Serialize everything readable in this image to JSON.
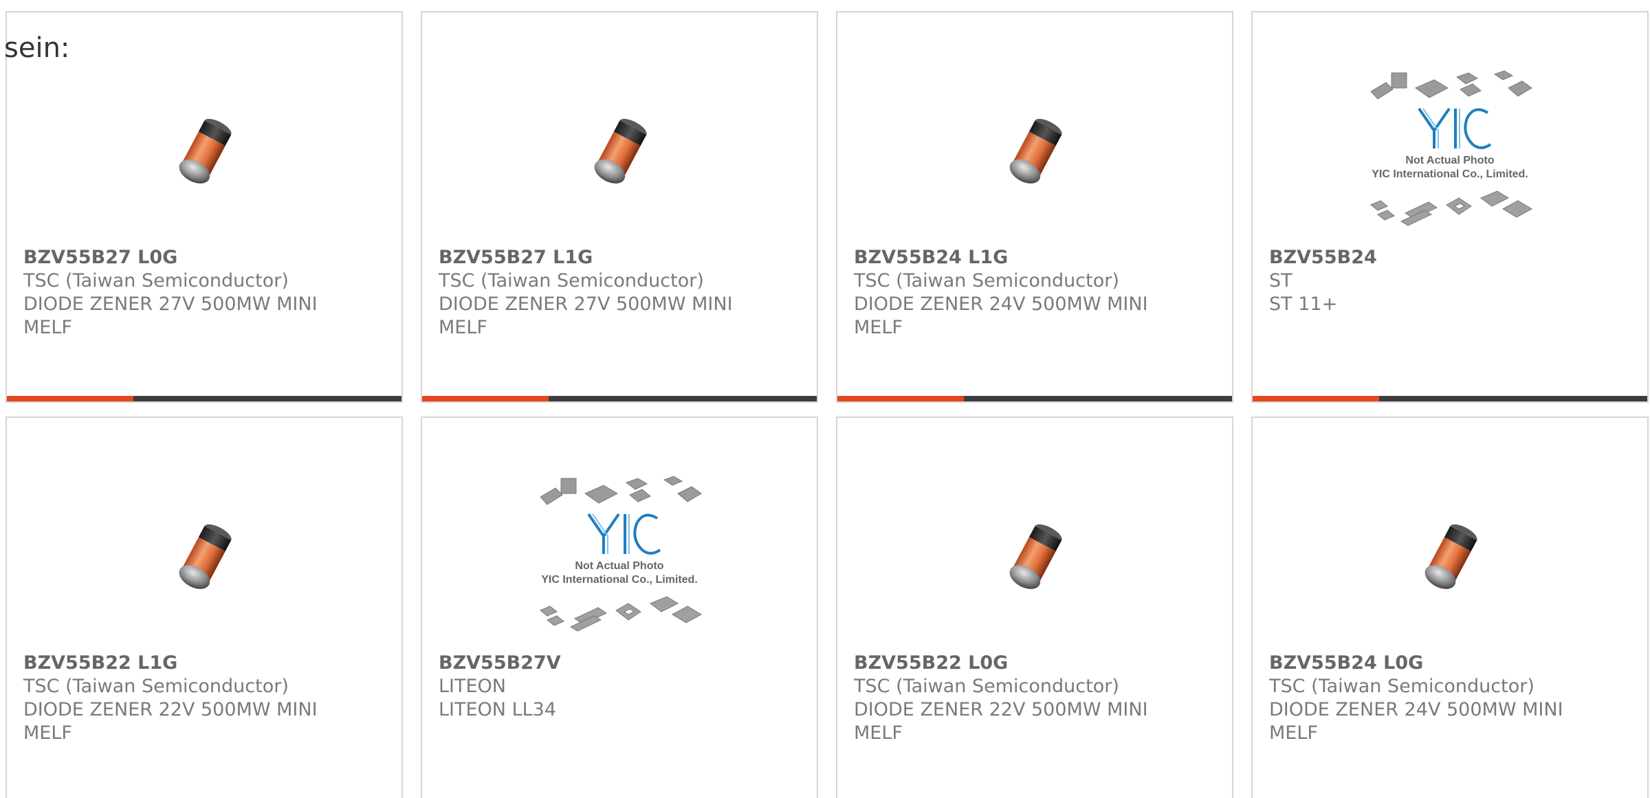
{
  "intro_text": "sein:",
  "colors": {
    "accent": "#e8451e",
    "bar_dark": "#3d3d3d",
    "border": "#d6d6d6",
    "text_gray": "#7a7a7a"
  },
  "placeholder_image": {
    "icon": "not-actual-photo-placeholder",
    "logo_text": "YIC",
    "line1": "Not Actual Photo",
    "line2": "YIC International Co., Limited."
  },
  "products": [
    {
      "part": "BZV55B27 L0G",
      "manufacturer": "TSC (Taiwan Semiconductor)",
      "description": "DIODE ZENER 27V 500MW MINI MELF",
      "image": "diode-icon",
      "progress": 0.32
    },
    {
      "part": "BZV55B27 L1G",
      "manufacturer": "TSC (Taiwan Semiconductor)",
      "description": "DIODE ZENER 27V 500MW MINI MELF",
      "image": "diode-icon",
      "progress": 0.32
    },
    {
      "part": "BZV55B24 L1G",
      "manufacturer": "TSC (Taiwan Semiconductor)",
      "description": "DIODE ZENER 24V 500MW MINI MELF",
      "image": "diode-icon",
      "progress": 0.32
    },
    {
      "part": "BZV55B24",
      "manufacturer": "ST",
      "description": "ST 11+",
      "image": "placeholder-icon",
      "progress": 0.32
    },
    {
      "part": "BZV55B22 L1G",
      "manufacturer": "TSC (Taiwan Semiconductor)",
      "description": "DIODE ZENER 22V 500MW MINI MELF",
      "image": "diode-icon"
    },
    {
      "part": "BZV55B27V",
      "manufacturer": "LITEON",
      "description": "LITEON LL34",
      "image": "placeholder-icon"
    },
    {
      "part": "BZV55B22 L0G",
      "manufacturer": "TSC (Taiwan Semiconductor)",
      "description": "DIODE ZENER 22V 500MW MINI MELF",
      "image": "diode-icon"
    },
    {
      "part": "BZV55B24 L0G",
      "manufacturer": "TSC (Taiwan Semiconductor)",
      "description": "DIODE ZENER 24V 500MW MINI MELF",
      "image": "diode-icon"
    }
  ]
}
